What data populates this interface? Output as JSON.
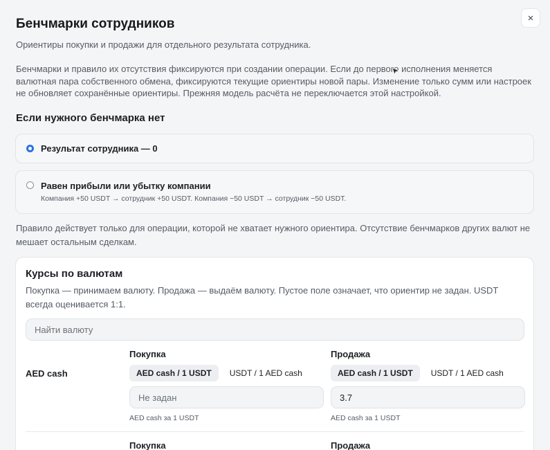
{
  "modal": {
    "title": "Бенчмарки сотрудников",
    "subtitle": "Ориентиры покупки и продажи для отдельного результата сотрудника.",
    "description": "Бенчмарки и правило их отсутствия фиксируются при создании операции. Если до первого исполнения меняется валютная пара собственного обмена, фиксируются текущие ориентиры новой пары. Изменение только сумм или настроек не обновляет сохранённые ориентиры. Прежняя модель расчёта не переключается этой настройкой.",
    "close_icon": "×"
  },
  "fallback": {
    "heading": "Если нужного бенчмарка нет",
    "options": [
      {
        "label": "Результат сотрудника — 0",
        "selected": true,
        "hint": ""
      },
      {
        "label": "Равен прибыли или убытку компании",
        "selected": false,
        "hint": "Компания +50 USDT → сотрудник +50 USDT. Компания −50 USDT → сотрудник −50 USDT."
      }
    ],
    "rule": "Правило действует только для операции, которой не хватает нужного ориентира. Отсутствие бенчмарков других валют не мешает остальным сделкам."
  },
  "rates": {
    "title": "Курсы по валютам",
    "description": "Покупка — принимаем валюту. Продажа — выдаём валюту. Пустое поле означает, что ориентир не задан. USDT всегда оценивается 1:1.",
    "search_placeholder": "Найти валюту",
    "rows": [
      {
        "currency": "AED cash",
        "buy": {
          "heading": "Покупка",
          "tabs": [
            "AED cash / 1 USDT",
            "USDT / 1 AED cash"
          ],
          "value": "",
          "placeholder": "Не задан",
          "hint": "AED cash за 1 USDT"
        },
        "sell": {
          "heading": "Продажа",
          "tabs": [
            "AED cash / 1 USDT",
            "USDT / 1 AED cash"
          ],
          "value": "3.7",
          "placeholder": "",
          "hint": "AED cash за 1 USDT"
        }
      },
      {
        "currency": "",
        "buy": {
          "heading": "Покупка"
        },
        "sell": {
          "heading": "Продажа"
        }
      }
    ]
  },
  "colors": {
    "accent": "#2f6fe4",
    "background": "#f4f5f7",
    "card": "#ffffff"
  }
}
